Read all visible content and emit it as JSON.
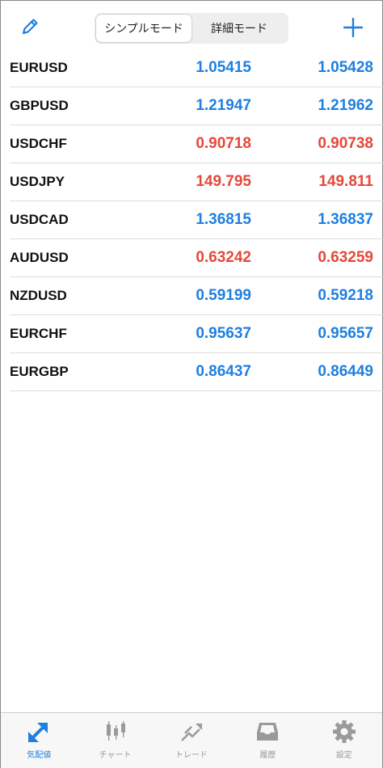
{
  "header": {
    "modes": [
      {
        "label": "シンプルモード",
        "active": true
      },
      {
        "label": "詳細モード",
        "active": false
      }
    ],
    "accent": "#1e7fe0"
  },
  "quotes": [
    {
      "symbol": "EURUSD",
      "bid": "1.05415",
      "ask": "1.05428",
      "color": "blue"
    },
    {
      "symbol": "GBPUSD",
      "bid": "1.21947",
      "ask": "1.21962",
      "color": "blue"
    },
    {
      "symbol": "USDCHF",
      "bid": "0.90718",
      "ask": "0.90738",
      "color": "red"
    },
    {
      "symbol": "USDJPY",
      "bid": "149.795",
      "ask": "149.811",
      "color": "red"
    },
    {
      "symbol": "USDCAD",
      "bid": "1.36815",
      "ask": "1.36837",
      "color": "blue"
    },
    {
      "symbol": "AUDUSD",
      "bid": "0.63242",
      "ask": "0.63259",
      "color": "red"
    },
    {
      "symbol": "NZDUSD",
      "bid": "0.59199",
      "ask": "0.59218",
      "color": "blue"
    },
    {
      "symbol": "EURCHF",
      "bid": "0.95637",
      "ask": "0.95657",
      "color": "blue"
    },
    {
      "symbol": "EURGBP",
      "bid": "0.86437",
      "ask": "0.86449",
      "color": "blue"
    }
  ],
  "tabs": [
    {
      "label": "気配値",
      "icon": "quotes-icon",
      "active": true
    },
    {
      "label": "チャート",
      "icon": "candlestick-chart-icon",
      "active": false
    },
    {
      "label": "トレード",
      "icon": "trade-icon",
      "active": false
    },
    {
      "label": "履歴",
      "icon": "history-inbox-icon",
      "active": false
    },
    {
      "label": "設定",
      "icon": "gear-icon",
      "active": false
    }
  ]
}
